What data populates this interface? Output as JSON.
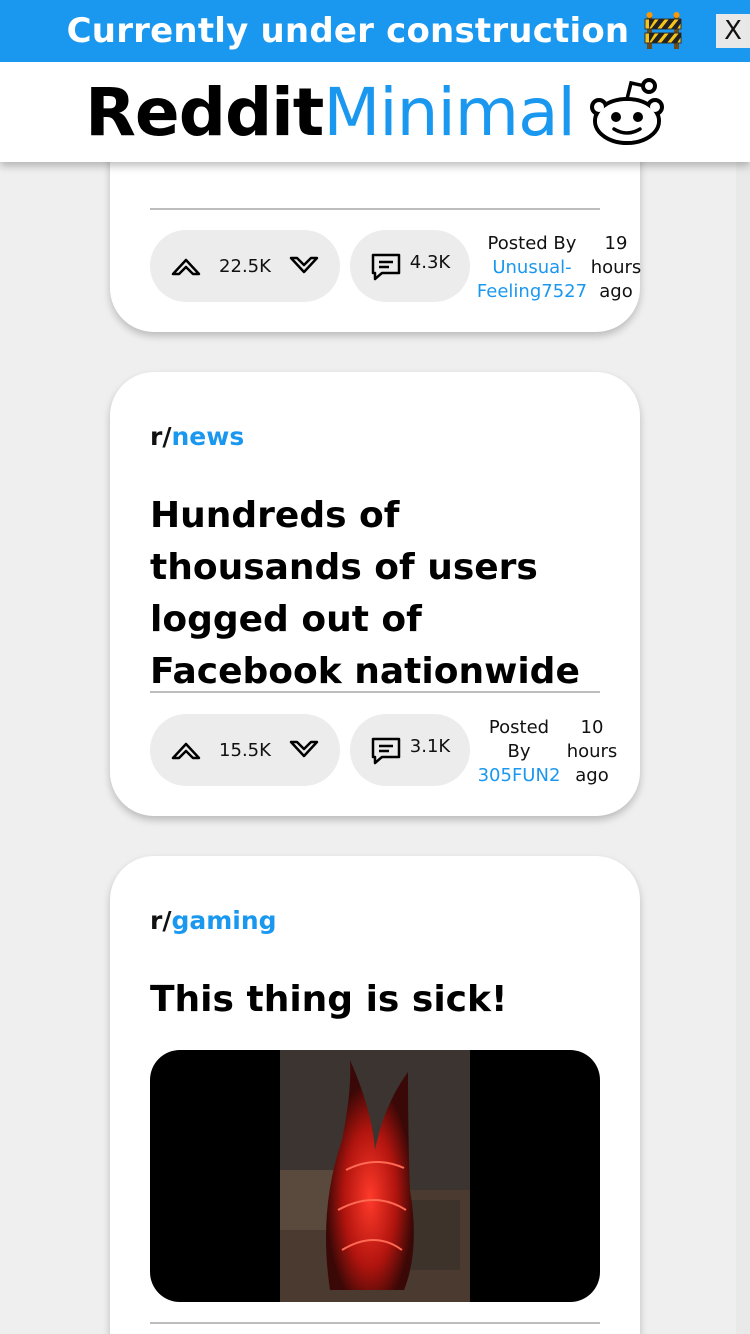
{
  "banner": {
    "text": "Currently under construction",
    "icon": "construction-barrier-icon",
    "close_label": "X"
  },
  "header": {
    "logo_part1": "Reddit",
    "logo_part2": "Minimal",
    "icon": "reddit-snoo-icon"
  },
  "colors": {
    "accent": "#1a98f0",
    "pill_bg": "#ececec",
    "page_bg": "#efefef"
  },
  "posts": [
    {
      "upvotes": "22.5K",
      "comments": "4.3K",
      "posted_label": "Posted By",
      "author": "Unusual-Feeling7527",
      "time": "19 hours ago"
    },
    {
      "subreddit_prefix": "r/",
      "subreddit": "news",
      "title": "Hundreds of thousands of users logged out of Facebook nationwide",
      "upvotes": "15.5K",
      "comments": "3.1K",
      "posted_label": "Posted By",
      "author": "305FUN2",
      "time": "10 hours ago"
    },
    {
      "subreddit_prefix": "r/",
      "subreddit": "gaming",
      "title": "This thing is sick!",
      "media": "video-thumbnail"
    }
  ]
}
